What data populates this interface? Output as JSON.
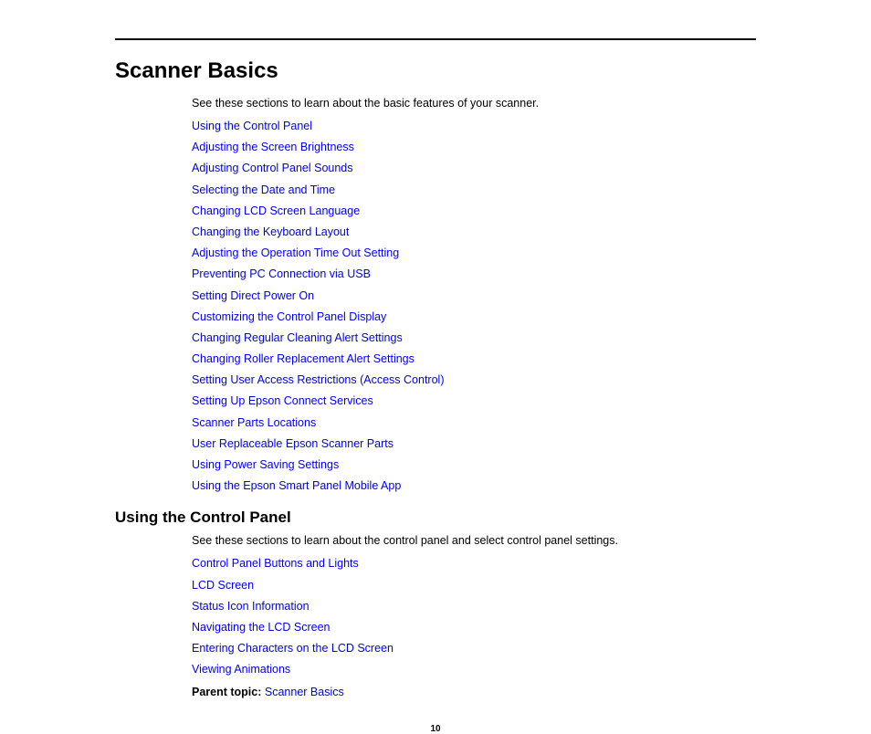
{
  "heading": "Scanner Basics",
  "intro": "See these sections to learn about the basic features of your scanner.",
  "links1": [
    "Using the Control Panel",
    "Adjusting the Screen Brightness",
    "Adjusting Control Panel Sounds",
    "Selecting the Date and Time",
    "Changing LCD Screen Language",
    "Changing the Keyboard Layout",
    "Adjusting the Operation Time Out Setting",
    "Preventing PC Connection via USB",
    "Setting Direct Power On",
    "Customizing the Control Panel Display",
    "Changing Regular Cleaning Alert Settings",
    "Changing Roller Replacement Alert Settings",
    "Setting User Access Restrictions (Access Control)",
    "Setting Up Epson Connect Services",
    "Scanner Parts Locations",
    "User Replaceable Epson Scanner Parts",
    "Using Power Saving Settings",
    "Using the Epson Smart Panel Mobile App"
  ],
  "subheading": "Using the Control Panel",
  "intro2": "See these sections to learn about the control panel and select control panel settings.",
  "links2": [
    "Control Panel Buttons and Lights",
    "LCD Screen",
    "Status Icon Information",
    "Navigating the LCD Screen",
    "Entering Characters on the LCD Screen",
    "Viewing Animations"
  ],
  "parent_label": "Parent topic: ",
  "parent_link": "Scanner Basics",
  "page_number": "10"
}
